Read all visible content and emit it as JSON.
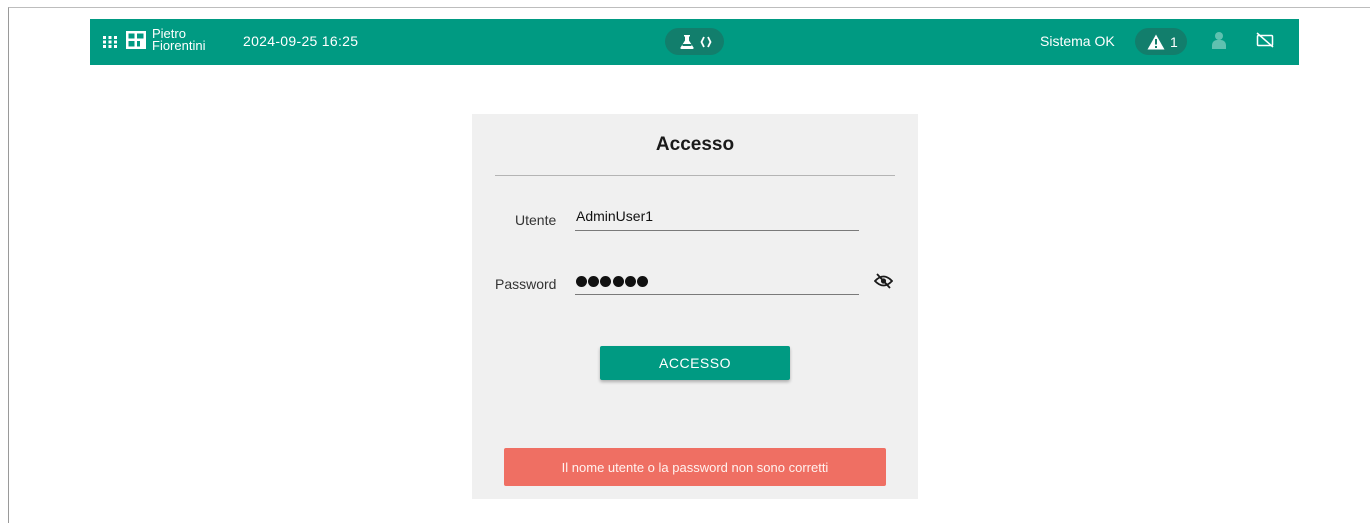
{
  "header": {
    "logo_line1": "Pietro",
    "logo_line2": "Fiorentini",
    "datetime": "2024-09-25 16:25",
    "status_text": "Sistema OK",
    "alert_count": "1",
    "icons": [
      "apps-grid-icon",
      "flask-icon",
      "code-brackets-icon",
      "warning-icon",
      "user-icon",
      "camera-off-icon"
    ]
  },
  "login": {
    "title": "Accesso",
    "user_label": "Utente",
    "user_value": "AdminUser1",
    "password_label": "Password",
    "password_mask": "●●●●●●",
    "submit_label": "ACCESSO",
    "error_message": "Il nome utente o la password non sono corretti"
  },
  "colors": {
    "brand": "#009a82",
    "pill": "#127e6c",
    "error": "#ef6f63",
    "panel": "#f0f0f0"
  }
}
